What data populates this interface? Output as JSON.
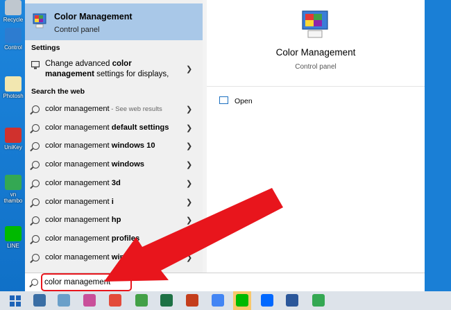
{
  "desktop": {
    "icons": [
      {
        "label": "Recycle",
        "color": "#bfc7cf"
      },
      {
        "label": "Control",
        "color": "#2d7cd0"
      },
      {
        "label": "Photosh",
        "color": "#f2e7b0"
      },
      {
        "label": "UniKey",
        "color": "#d0312d"
      },
      {
        "label": "vn thambo",
        "color": "#34a853"
      },
      {
        "label": "LINE",
        "color": "#00b900"
      }
    ]
  },
  "best_match": {
    "title": "Color Management",
    "subtitle": "Control panel"
  },
  "settings": {
    "heading": "Settings",
    "item_text_plain1": "Change advanced ",
    "item_text_bold1": "color management",
    "item_text_plain2": " settings for displays,"
  },
  "web": {
    "heading": "Search the web",
    "items": [
      {
        "plain": "color management",
        "bold": "",
        "muted": " - See web results"
      },
      {
        "plain": "color management ",
        "bold": "default settings",
        "muted": ""
      },
      {
        "plain": "color management ",
        "bold": "windows 10",
        "muted": ""
      },
      {
        "plain": "color management ",
        "bold": "windows",
        "muted": ""
      },
      {
        "plain": "color management ",
        "bold": "3d",
        "muted": ""
      },
      {
        "plain": "color management ",
        "bold": "i",
        "muted": ""
      },
      {
        "plain": "color management ",
        "bold": "hp",
        "muted": ""
      },
      {
        "plain": "color management ",
        "bold": "profiles",
        "muted": ""
      },
      {
        "plain": "color management ",
        "bold": "windows 7",
        "muted": ""
      }
    ]
  },
  "preview": {
    "title": "Color Management",
    "subtitle": "Control panel",
    "open_label": "Open"
  },
  "search": {
    "value": "color management",
    "highlight_color": "#e8151c"
  },
  "annotation": {
    "arrow_color": "#e8151c"
  },
  "taskbar": {
    "icons": [
      {
        "name": "task-view-icon",
        "color": "#3a6ea5"
      },
      {
        "name": "files-app-icon",
        "color": "#6a9fc9"
      },
      {
        "name": "paint-app-icon",
        "color": "#c94f9a"
      },
      {
        "name": "photos-app-icon",
        "color": "#e34b3b"
      },
      {
        "name": "refresh-app-icon",
        "color": "#43a047"
      },
      {
        "name": "excel-icon",
        "color": "#1e7145"
      },
      {
        "name": "powerpoint-icon",
        "color": "#c43e1c"
      },
      {
        "name": "chrome-icon",
        "color": "#4285f4"
      },
      {
        "name": "line-app-icon",
        "color": "#00b900"
      },
      {
        "name": "zalo-icon",
        "color": "#0068ff"
      },
      {
        "name": "word-icon",
        "color": "#2b579a"
      },
      {
        "name": "chrome-alt-icon",
        "color": "#34a853"
      }
    ]
  }
}
